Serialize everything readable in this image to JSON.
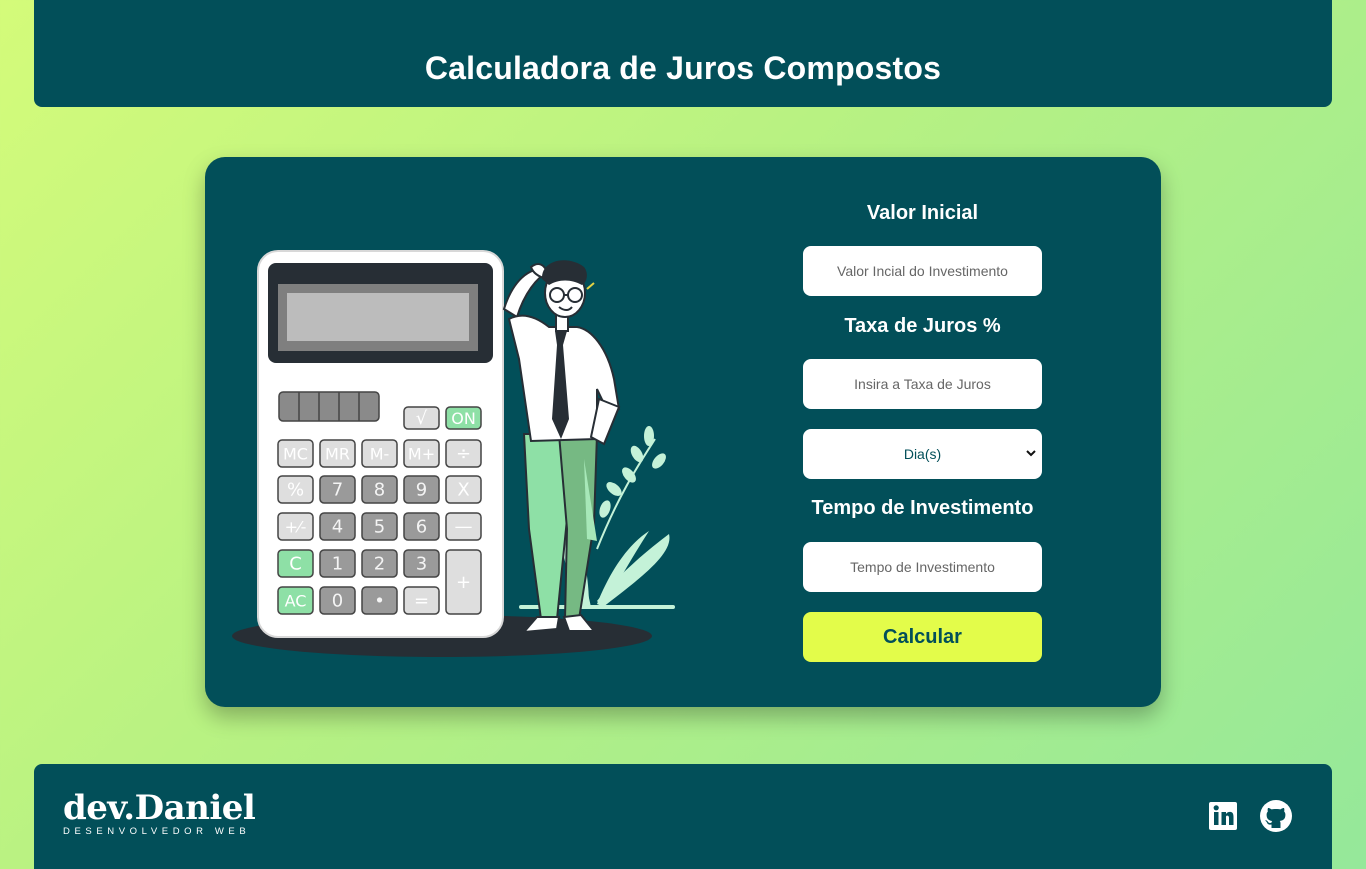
{
  "header": {
    "title": "Calculadora de Juros Compostos"
  },
  "form": {
    "initial_label": "Valor Inicial",
    "initial_placeholder": "Valor Incial do Investimento",
    "rate_label": "Taxa de Juros %",
    "rate_placeholder": "Insira a Taxa de Juros",
    "period_selected": "Dia(s)",
    "time_label": "Tempo de Investimento",
    "time_placeholder": "Tempo de Investimento",
    "submit_label": "Calcular"
  },
  "calculator_keys": {
    "row0": [
      "√",
      "ON"
    ],
    "row1": [
      "MC",
      "MR",
      "M-",
      "M+",
      "÷"
    ],
    "row2": [
      "%",
      "7",
      "8",
      "9",
      "X"
    ],
    "row3": [
      "+⁄-",
      "4",
      "5",
      "6",
      "—"
    ],
    "row4": [
      "C",
      "1",
      "2",
      "3",
      "+"
    ],
    "row5": [
      "AC",
      "0",
      "•",
      "="
    ]
  },
  "footer": {
    "logo_name": "dev.Daniel",
    "logo_tagline": "DESENVOLVEDOR WEB"
  },
  "icons": [
    "linkedin-icon",
    "github-icon",
    "chevron-down-icon"
  ],
  "colors": {
    "panel": "#024f59",
    "accent": "#e3fc4a",
    "key_green": "#8ee0a6",
    "key_grey": "#9a9a9a",
    "leaf": "#c4f2d8"
  }
}
